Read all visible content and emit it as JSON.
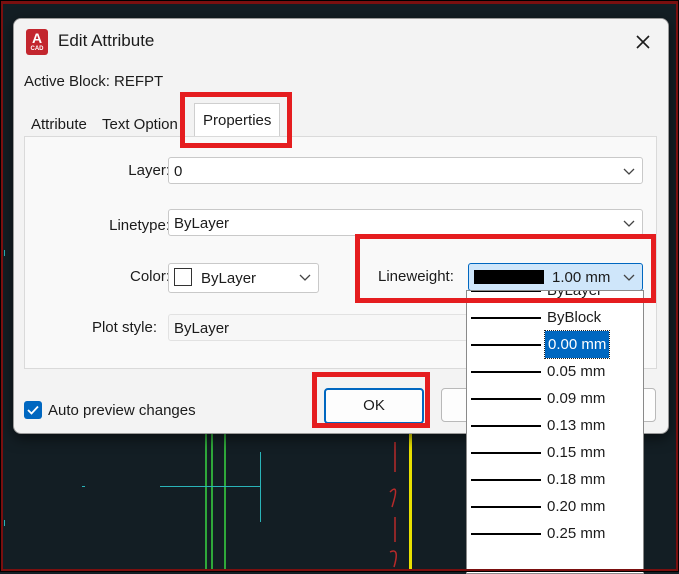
{
  "window": {
    "title": "Edit Attribute",
    "app_icon_letter": "A",
    "app_icon_subtext": "CAD",
    "close_icon": "close-icon"
  },
  "active_block": "Active Block: REFPT",
  "tabs": [
    {
      "label": "Attribute"
    },
    {
      "label": "Text Option"
    },
    {
      "label": "Properties",
      "selected": true
    }
  ],
  "properties": {
    "layer": {
      "label": "Layer:",
      "value": "0"
    },
    "linetype": {
      "label": "Linetype:",
      "value": "ByLayer"
    },
    "color": {
      "label": "Color:",
      "value": "ByLayer"
    },
    "lineweight": {
      "label": "Lineweight:",
      "value": "1.00 mm"
    },
    "plot_style": {
      "label": "Plot style:",
      "value": "ByLayer"
    }
  },
  "lineweight_options": [
    {
      "label": "ByLayer"
    },
    {
      "label": "ByBlock"
    },
    {
      "label": "0.00 mm",
      "selected": true
    },
    {
      "label": "0.05 mm"
    },
    {
      "label": "0.09 mm"
    },
    {
      "label": "0.13 mm"
    },
    {
      "label": "0.15 mm"
    },
    {
      "label": "0.18 mm"
    },
    {
      "label": "0.20 mm"
    },
    {
      "label": "0.25 mm"
    }
  ],
  "auto_preview": {
    "label": "Auto preview changes",
    "checked": true
  },
  "buttons": {
    "ok": "OK"
  },
  "colors": {
    "accent": "#0067c0",
    "highlight": "#e51d1f",
    "background": "#131e24",
    "frame": "#7a0f0f"
  }
}
